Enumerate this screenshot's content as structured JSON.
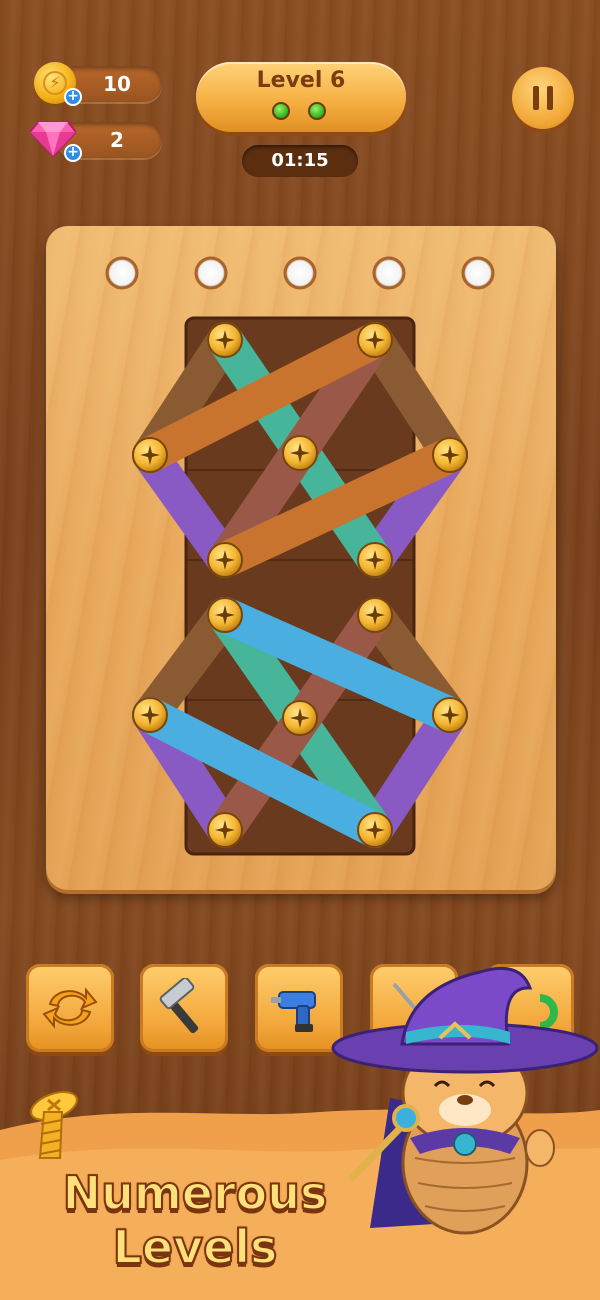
{
  "hud": {
    "coins": "10",
    "gems": "2",
    "coin_icon": "gold-coin-icon",
    "gem_icon": "pink-gem-icon",
    "plus_icon": "plus-icon"
  },
  "level": {
    "title": "Level 6",
    "progress_dots": 2,
    "timer": "01:15"
  },
  "pause_icon": "pause-icon",
  "board": {
    "empty_holes": 5,
    "plank_colors": [
      "#c8742f",
      "#46b59a",
      "#8e4f3c",
      "#8a5ac4",
      "#4aaee0",
      "#7a4a2a"
    ]
  },
  "tools": [
    {
      "name": "shuffle",
      "icon": "shuffle-arrows-icon"
    },
    {
      "name": "hammer",
      "icon": "hammer-icon"
    },
    {
      "name": "drill",
      "icon": "drill-icon"
    },
    {
      "name": "screwdriver",
      "icon": "screwdriver-icon"
    },
    {
      "name": "magnet",
      "icon": "magnet-icon"
    }
  ],
  "promo": {
    "line1": "Numerous",
    "line2": "Levels"
  },
  "mascot_icon": "wizard-mascot-icon",
  "screw_icon": "golden-screw-icon"
}
